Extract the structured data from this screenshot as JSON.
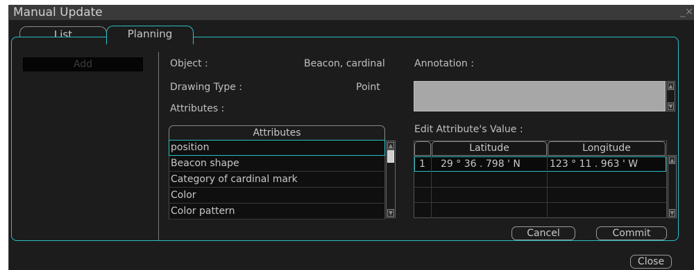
{
  "window": {
    "title": "Manual Update",
    "close_glyph": "_×"
  },
  "tabs": [
    {
      "label": "List",
      "active": false
    },
    {
      "label": "Planning",
      "active": true
    }
  ],
  "left": {
    "add_label": "Add"
  },
  "object": {
    "label": "Object :",
    "value": "Beacon, cardinal"
  },
  "drawing_type": {
    "label": "Drawing Type :",
    "value": "Point"
  },
  "attributes": {
    "label": "Attributes :",
    "header": "Attributes",
    "items": [
      "position",
      "Beacon shape",
      "Category of cardinal mark",
      "Color",
      "Color pattern"
    ],
    "selected_index": 0
  },
  "annotation": {
    "label": "Annotation :",
    "value": ""
  },
  "edit_value": {
    "label": "Edit Attribute's Value :",
    "columns": [
      "Latitude",
      "Longitude"
    ],
    "rows": [
      {
        "num": "1",
        "latitude": "29 ° 36 . 798 ' N",
        "longitude": "123 ° 11 . 963 ' W"
      }
    ]
  },
  "buttons": {
    "cancel": "Cancel",
    "commit": "Commit",
    "close": "Close"
  },
  "colors": {
    "accent": "#2bc0c8",
    "background": "#1c1c1c",
    "annotation_box": "#a7a7a7"
  }
}
